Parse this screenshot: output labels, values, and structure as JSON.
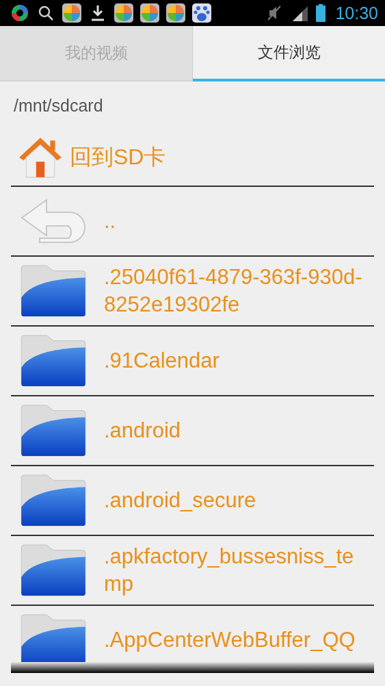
{
  "status_bar": {
    "time": "10:30"
  },
  "tabs": [
    {
      "label": "我的视频",
      "selected": false
    },
    {
      "label": "文件浏览",
      "selected": true
    }
  ],
  "path": "/mnt/sdcard",
  "home_link": {
    "label": "回到SD卡"
  },
  "entries": [
    {
      "kind": "up",
      "name": ".."
    },
    {
      "kind": "folder",
      "name": ".25040f61-4879-363f-930d-8252e19302fe"
    },
    {
      "kind": "folder",
      "name": ".91Calendar"
    },
    {
      "kind": "folder",
      "name": ".android"
    },
    {
      "kind": "folder",
      "name": ".android_secure"
    },
    {
      "kind": "folder",
      "name": ".apkfactory_bussesniss_temp"
    },
    {
      "kind": "folder",
      "name": ".AppCenterWebBuffer_QQ"
    }
  ]
}
